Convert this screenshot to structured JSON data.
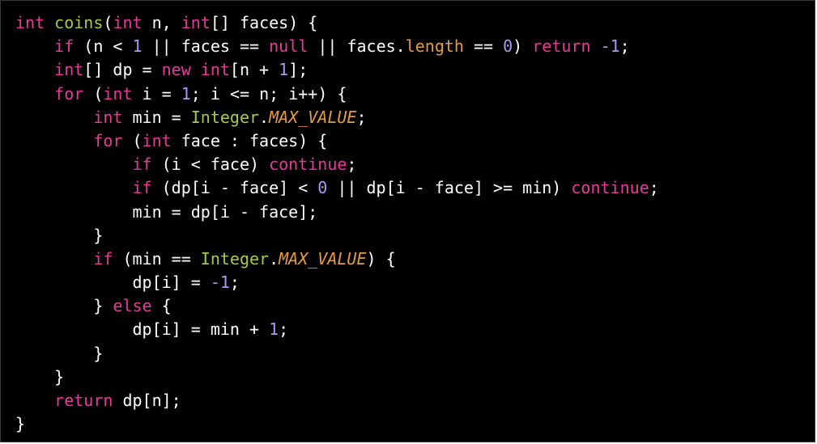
{
  "colors": {
    "background": "#000000",
    "plain": "#ffffff",
    "keyword": "#e8399a",
    "function": "#a9c948",
    "number": "#a79cf0",
    "property": "#e59b3c"
  },
  "code": {
    "language": "java",
    "lines": [
      {
        "indent": 0,
        "tokens": [
          {
            "t": "int",
            "k": "keyword"
          },
          {
            "t": " ",
            "k": "plain"
          },
          {
            "t": "coins",
            "k": "function"
          },
          {
            "t": "(",
            "k": "plain"
          },
          {
            "t": "int",
            "k": "keyword"
          },
          {
            "t": " n, ",
            "k": "plain"
          },
          {
            "t": "int",
            "k": "keyword"
          },
          {
            "t": "[] faces) {",
            "k": "plain"
          }
        ]
      },
      {
        "indent": 1,
        "tokens": [
          {
            "t": "if",
            "k": "keyword"
          },
          {
            "t": " (n < ",
            "k": "plain"
          },
          {
            "t": "1",
            "k": "number"
          },
          {
            "t": " || faces == ",
            "k": "plain"
          },
          {
            "t": "null",
            "k": "keyword"
          },
          {
            "t": " || faces.",
            "k": "plain"
          },
          {
            "t": "length",
            "k": "property"
          },
          {
            "t": " == ",
            "k": "plain"
          },
          {
            "t": "0",
            "k": "number"
          },
          {
            "t": ") ",
            "k": "plain"
          },
          {
            "t": "return",
            "k": "keyword"
          },
          {
            "t": " ",
            "k": "plain"
          },
          {
            "t": "-1",
            "k": "number"
          },
          {
            "t": ";",
            "k": "plain"
          }
        ]
      },
      {
        "indent": 1,
        "tokens": [
          {
            "t": "int",
            "k": "keyword"
          },
          {
            "t": "[] dp = ",
            "k": "plain"
          },
          {
            "t": "new",
            "k": "keyword"
          },
          {
            "t": " ",
            "k": "plain"
          },
          {
            "t": "int",
            "k": "keyword"
          },
          {
            "t": "[n + ",
            "k": "plain"
          },
          {
            "t": "1",
            "k": "number"
          },
          {
            "t": "];",
            "k": "plain"
          }
        ]
      },
      {
        "indent": 1,
        "tokens": [
          {
            "t": "for",
            "k": "keyword"
          },
          {
            "t": " (",
            "k": "plain"
          },
          {
            "t": "int",
            "k": "keyword"
          },
          {
            "t": " i = ",
            "k": "plain"
          },
          {
            "t": "1",
            "k": "number"
          },
          {
            "t": "; i <= n; i++) {",
            "k": "plain"
          }
        ]
      },
      {
        "indent": 2,
        "tokens": [
          {
            "t": "int",
            "k": "keyword"
          },
          {
            "t": " min = ",
            "k": "plain"
          },
          {
            "t": "Integer",
            "k": "function"
          },
          {
            "t": ".",
            "k": "plain"
          },
          {
            "t": "MAX_VALUE",
            "k": "property",
            "italic": true
          },
          {
            "t": ";",
            "k": "plain"
          }
        ]
      },
      {
        "indent": 2,
        "tokens": [
          {
            "t": "for",
            "k": "keyword"
          },
          {
            "t": " (",
            "k": "plain"
          },
          {
            "t": "int",
            "k": "keyword"
          },
          {
            "t": " face : faces) {",
            "k": "plain"
          }
        ]
      },
      {
        "indent": 3,
        "tokens": [
          {
            "t": "if",
            "k": "keyword"
          },
          {
            "t": " (i < face) ",
            "k": "plain"
          },
          {
            "t": "continue",
            "k": "keyword"
          },
          {
            "t": ";",
            "k": "plain"
          }
        ]
      },
      {
        "indent": 3,
        "tokens": [
          {
            "t": "if",
            "k": "keyword"
          },
          {
            "t": " (dp[i - face] < ",
            "k": "plain"
          },
          {
            "t": "0",
            "k": "number"
          },
          {
            "t": " || dp[i - face] >= min) ",
            "k": "plain"
          },
          {
            "t": "continue",
            "k": "keyword"
          },
          {
            "t": ";",
            "k": "plain"
          }
        ]
      },
      {
        "indent": 3,
        "tokens": [
          {
            "t": "min = dp[i - face];",
            "k": "plain"
          }
        ]
      },
      {
        "indent": 2,
        "tokens": [
          {
            "t": "}",
            "k": "plain"
          }
        ]
      },
      {
        "indent": 2,
        "tokens": [
          {
            "t": "if",
            "k": "keyword"
          },
          {
            "t": " (min == ",
            "k": "plain"
          },
          {
            "t": "Integer",
            "k": "function"
          },
          {
            "t": ".",
            "k": "plain"
          },
          {
            "t": "MAX_VALUE",
            "k": "property",
            "italic": true
          },
          {
            "t": ") {",
            "k": "plain"
          }
        ]
      },
      {
        "indent": 3,
        "tokens": [
          {
            "t": "dp[i] = ",
            "k": "plain"
          },
          {
            "t": "-1",
            "k": "number"
          },
          {
            "t": ";",
            "k": "plain"
          }
        ]
      },
      {
        "indent": 2,
        "tokens": [
          {
            "t": "} ",
            "k": "plain"
          },
          {
            "t": "else",
            "k": "keyword"
          },
          {
            "t": " {",
            "k": "plain"
          }
        ]
      },
      {
        "indent": 3,
        "tokens": [
          {
            "t": "dp[i] = min + ",
            "k": "plain"
          },
          {
            "t": "1",
            "k": "number"
          },
          {
            "t": ";",
            "k": "plain"
          }
        ]
      },
      {
        "indent": 2,
        "tokens": [
          {
            "t": "}",
            "k": "plain"
          }
        ]
      },
      {
        "indent": 1,
        "tokens": [
          {
            "t": "}",
            "k": "plain"
          }
        ]
      },
      {
        "indent": 1,
        "tokens": [
          {
            "t": "return",
            "k": "keyword"
          },
          {
            "t": " dp[n];",
            "k": "plain"
          }
        ]
      },
      {
        "indent": 0,
        "tokens": [
          {
            "t": "}",
            "k": "plain"
          }
        ]
      }
    ]
  }
}
